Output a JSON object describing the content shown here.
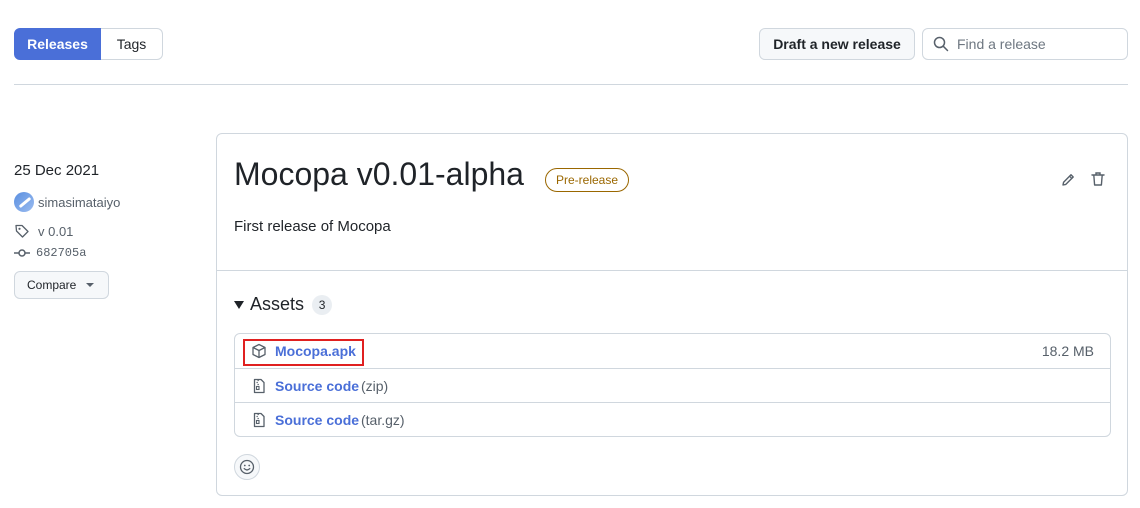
{
  "toolbar": {
    "tabs": [
      {
        "label": "Releases",
        "active": true
      },
      {
        "label": "Tags",
        "active": false
      }
    ],
    "draft_label": "Draft a new release",
    "search_placeholder": "Find a release"
  },
  "sidebar": {
    "date": "25 Dec 2021",
    "author": "simasimataiyo",
    "tag": "v 0.01",
    "commit": "682705a",
    "compare_label": "Compare"
  },
  "release": {
    "title": "Mocopa v0.01-alpha",
    "badge": "Pre-release",
    "description": "First release of Mocopa"
  },
  "assets": {
    "heading": "Assets",
    "count": "3",
    "items": [
      {
        "name": "Mocopa.apk",
        "ext": "",
        "size": "18.2 MB",
        "icon": "package-icon"
      },
      {
        "name": "Source code",
        "ext": "(zip)",
        "size": "",
        "icon": "file-zip-icon"
      },
      {
        "name": "Source code",
        "ext": "(tar.gz)",
        "size": "",
        "icon": "file-zip-icon"
      }
    ]
  },
  "colors": {
    "accent": "#4a6fd8",
    "prerelease": "#9a6700",
    "highlight": "#e02020"
  }
}
